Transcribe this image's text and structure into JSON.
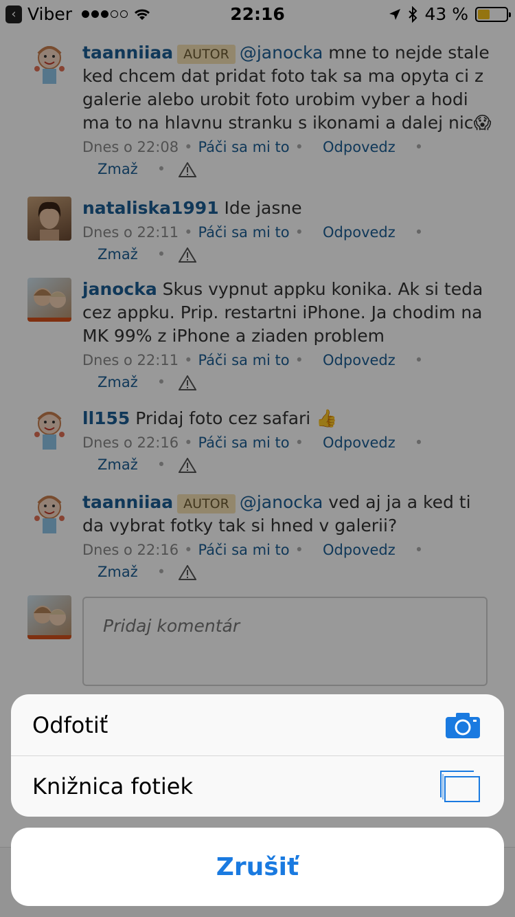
{
  "status_bar": {
    "carrier": "Viber",
    "time": "22:16",
    "battery_percent": "43 %",
    "battery_level": 0.43,
    "battery_color": "#f7c21b"
  },
  "comments": [
    {
      "username": "taanniiaa",
      "badge": "AUTOR",
      "mention": "@janocka",
      "text": " mne to nejde stale ked chcem dat pridat foto tak sa ma opyta ci z galerie alebo urobit foto urobim vyber a hodi ma to na hlavnu stranku s ikonami a dalej nic",
      "emoji": "😱",
      "time": "Dnes o 22:08",
      "like": "Páči sa mi to",
      "reply": "Odpovedz",
      "delete": "Zmaž"
    },
    {
      "username": "nataliska1991",
      "text": " Ide jasne",
      "time": "Dnes o 22:11",
      "like": "Páči sa mi to",
      "reply": "Odpovedz",
      "delete": "Zmaž"
    },
    {
      "username": "janocka",
      "text": " Skus vypnut appku konika. Ak si teda cez appku. Prip. restartni iPhone. Ja chodim na MK 99% z iPhone a ziaden problem",
      "time": "Dnes o 22:11",
      "like": "Páči sa mi to",
      "reply": "Odpovedz",
      "delete": "Zmaž"
    },
    {
      "username": "ll155",
      "text": " Pridaj foto cez safari",
      "emoji": "👍",
      "time": "Dnes o 22:16",
      "like": "Páči sa mi to",
      "reply": "Odpovedz",
      "delete": "Zmaž"
    },
    {
      "username": "taanniiaa",
      "badge": "AUTOR",
      "mention": "@janocka",
      "text": " ved aj ja a ked ti da vybrat fotky tak si hned v galerii?",
      "time": "Dnes o 22:16",
      "like": "Páči sa mi to",
      "reply": "Odpovedz",
      "delete": "Zmaž"
    }
  ],
  "comment_input": {
    "placeholder": "Pridaj komentár"
  },
  "action_sheet": {
    "take_photo": "Odfotiť",
    "photo_library": "Knižnica fotiek",
    "cancel": "Zrušiť",
    "accent_color": "#1a7ae0"
  }
}
